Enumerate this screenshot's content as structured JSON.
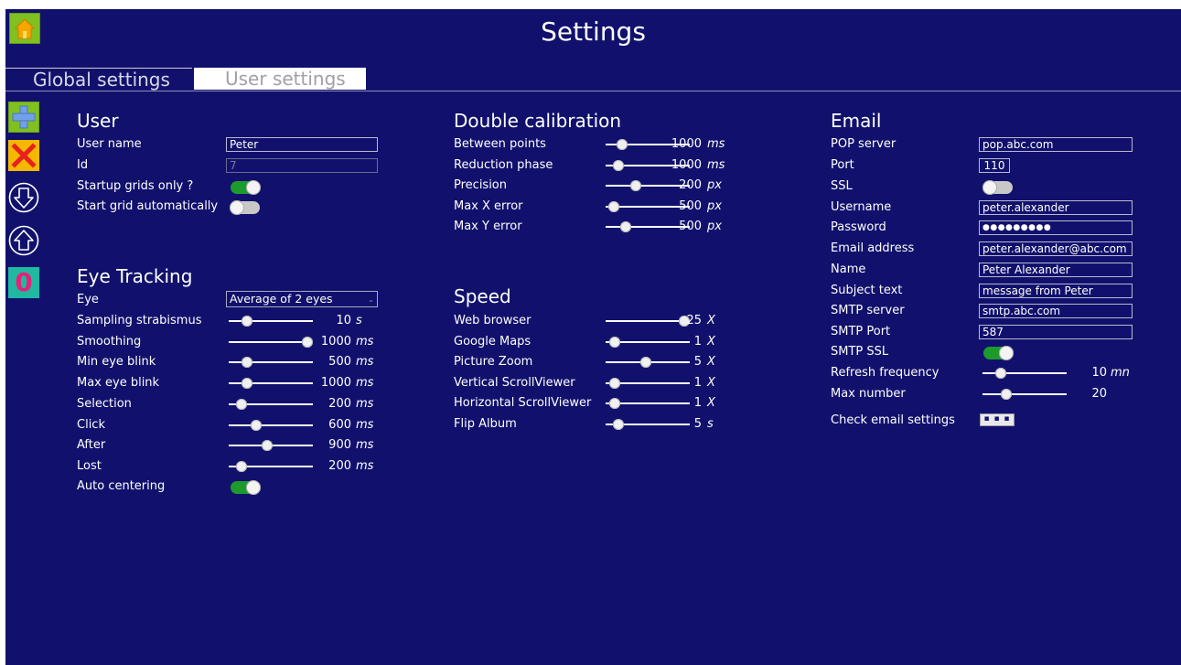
{
  "title": "Settings",
  "tabs": {
    "global": "Global settings",
    "user": "User settings"
  },
  "sidebar": {
    "reset_label": "0"
  },
  "user": {
    "title": "User",
    "user_name": {
      "label": "User name",
      "value": "Peter"
    },
    "id": {
      "label": "Id",
      "value": "7"
    },
    "startup_grids_only": {
      "label": "Startup grids only ?",
      "on": true
    },
    "start_grid_automatically": {
      "label": "Start grid automatically",
      "on": false
    }
  },
  "eye_tracking": {
    "title": "Eye Tracking",
    "eye": {
      "label": "Eye",
      "value": "Average of 2 eyes"
    },
    "sliders": [
      {
        "label": "Sampling strabismus",
        "value": "10",
        "unit": "s",
        "level": 0.18
      },
      {
        "label": "Smoothing",
        "value": "1000",
        "unit": "ms",
        "level": 1.0
      },
      {
        "label": "Min eye blink",
        "value": "500",
        "unit": "ms",
        "level": 0.18
      },
      {
        "label": "Max eye blink",
        "value": "1000",
        "unit": "ms",
        "level": 0.18
      },
      {
        "label": "Selection",
        "value": "200",
        "unit": "ms",
        "level": 0.1
      },
      {
        "label": "Click",
        "value": "600",
        "unit": "ms",
        "level": 0.3
      },
      {
        "label": "After",
        "value": "900",
        "unit": "ms",
        "level": 0.45
      },
      {
        "label": "Lost",
        "value": "200",
        "unit": "ms",
        "level": 0.1
      }
    ],
    "auto_centering": {
      "label": "Auto centering",
      "on": true
    }
  },
  "double_calibration": {
    "title": "Double calibration",
    "sliders": [
      {
        "label": "Between points",
        "value": "1000",
        "unit": "ms",
        "level": 0.15
      },
      {
        "label": "Reduction phase",
        "value": "1000",
        "unit": "ms",
        "level": 0.1
      },
      {
        "label": "Precision",
        "value": "200",
        "unit": "px",
        "level": 0.34
      },
      {
        "label": "Max X error",
        "value": "500",
        "unit": "px",
        "level": 0.04
      },
      {
        "label": "Max Y error",
        "value": "500",
        "unit": "px",
        "level": 0.2
      }
    ]
  },
  "speed": {
    "title": "Speed",
    "sliders": [
      {
        "label": "Web browser",
        "value": "25",
        "unit": "X",
        "level": 1.0
      },
      {
        "label": "Google Maps",
        "value": "1",
        "unit": "X",
        "level": 0.05
      },
      {
        "label": "Picture Zoom",
        "value": "5",
        "unit": "X",
        "level": 0.47
      },
      {
        "label": "Vertical ScrollViewer",
        "value": "1",
        "unit": "X",
        "level": 0.05
      },
      {
        "label": "Horizontal ScrollViewer",
        "value": "1",
        "unit": "X",
        "level": 0.05
      },
      {
        "label": "Flip Album",
        "value": "5",
        "unit": "s",
        "level": 0.1
      }
    ]
  },
  "email": {
    "title": "Email",
    "pop_server": {
      "label": "POP server",
      "value": "pop.abc.com"
    },
    "port": {
      "label": "Port",
      "value": "110"
    },
    "ssl": {
      "label": "SSL",
      "on": false
    },
    "username": {
      "label": "Username",
      "value": "peter.alexander"
    },
    "password": {
      "label": "Password",
      "value": "●●●●●●●●●"
    },
    "email_address": {
      "label": "Email address",
      "value": "peter.alexander@abc.com"
    },
    "name": {
      "label": "Name",
      "value": "Peter Alexander"
    },
    "subject_text": {
      "label": "Subject text",
      "value": "message from Peter"
    },
    "smtp_server": {
      "label": "SMTP server",
      "value": "smtp.abc.com"
    },
    "smtp_port": {
      "label": "SMTP Port",
      "value": "587"
    },
    "smtp_ssl": {
      "label": "SMTP SSL",
      "on": true
    },
    "refresh_frequency": {
      "label": "Refresh frequency",
      "value": "10",
      "unit": "mn",
      "level": 0.18
    },
    "max_number": {
      "label": "Max number",
      "value": "20",
      "unit": "",
      "level": 0.25
    },
    "check_email_settings": {
      "label": "Check email settings",
      "button": "▪ ▪ ▪"
    }
  },
  "colors": {
    "background": "#11116d",
    "toggle_on": "#1c9a2c",
    "accent_green": "#80c020",
    "delete_yellow": "#f4b800",
    "reset_teal": "#20b8a0",
    "reset_digit": "#e8207a"
  }
}
